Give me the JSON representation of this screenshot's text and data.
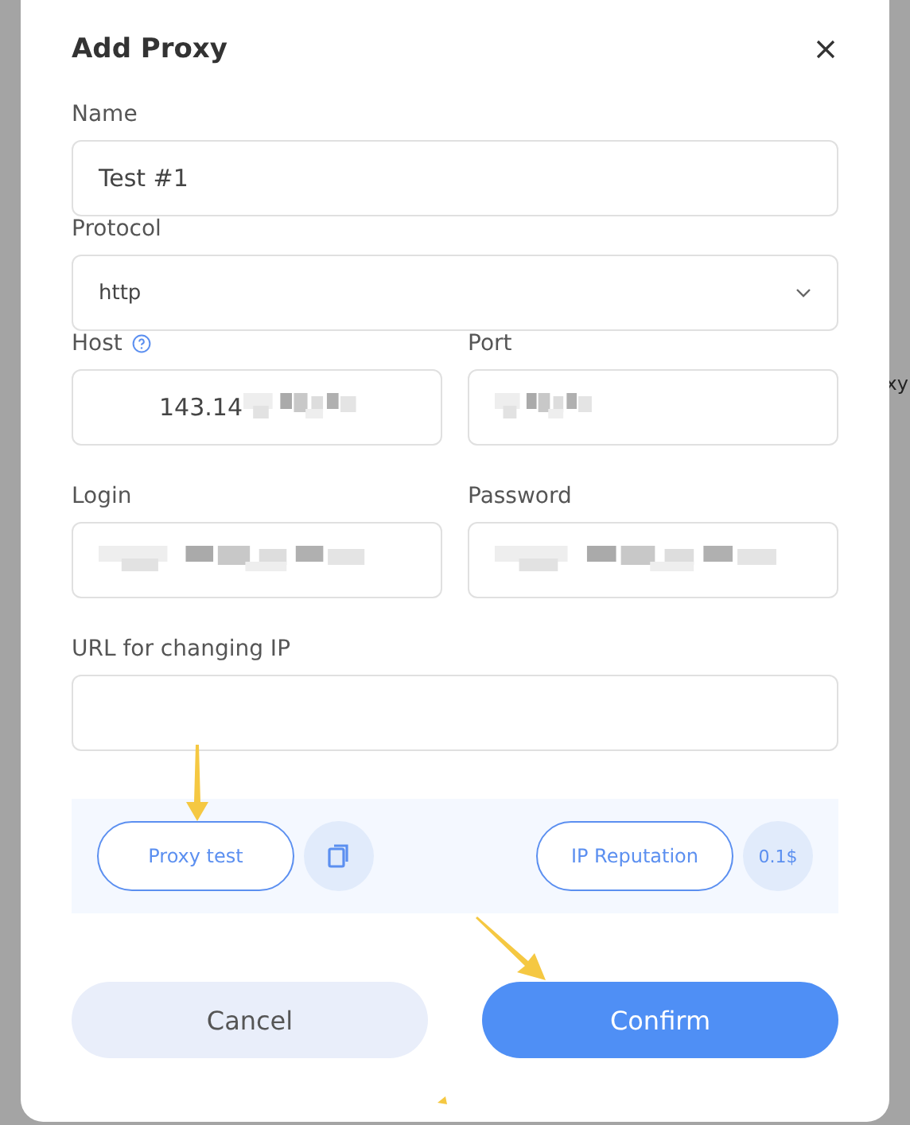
{
  "backdrop": {
    "text": "xy"
  },
  "dialog": {
    "title": "Add Proxy"
  },
  "fields": [
    {
      "label": "Name",
      "kind": "input",
      "wide": true,
      "value": "Test #1",
      "redacted": false,
      "help": false
    },
    {
      "label": "Protocol",
      "kind": "select",
      "wide": true,
      "value": "http",
      "redacted": false,
      "help": false
    },
    {
      "label": "Host",
      "kind": "input",
      "wide": false,
      "value": "143.14",
      "redacted": true,
      "help": true
    },
    {
      "label": "Port",
      "kind": "input",
      "wide": false,
      "redacted": true,
      "help": false
    },
    {
      "label": "Login",
      "kind": "input",
      "wide": false,
      "redacted": true,
      "help": false
    },
    {
      "label": "Password",
      "kind": "input",
      "wide": false,
      "redacted": true,
      "help": false
    },
    {
      "label": "URL for changing IP",
      "kind": "input",
      "wide": true,
      "redacted": false,
      "help": false
    }
  ],
  "tools": {
    "test": {
      "label": "Proxy test"
    },
    "reputation": {
      "label": "IP Reputation",
      "price": "0.1$"
    }
  },
  "actions": [
    {
      "label": "Cancel",
      "kind": "secondary"
    },
    {
      "label": "Confirm",
      "kind": "primary"
    }
  ],
  "annotations": [
    {
      "kind": "down"
    },
    {
      "kind": "diagonal"
    },
    {
      "kind": "stub"
    }
  ]
}
